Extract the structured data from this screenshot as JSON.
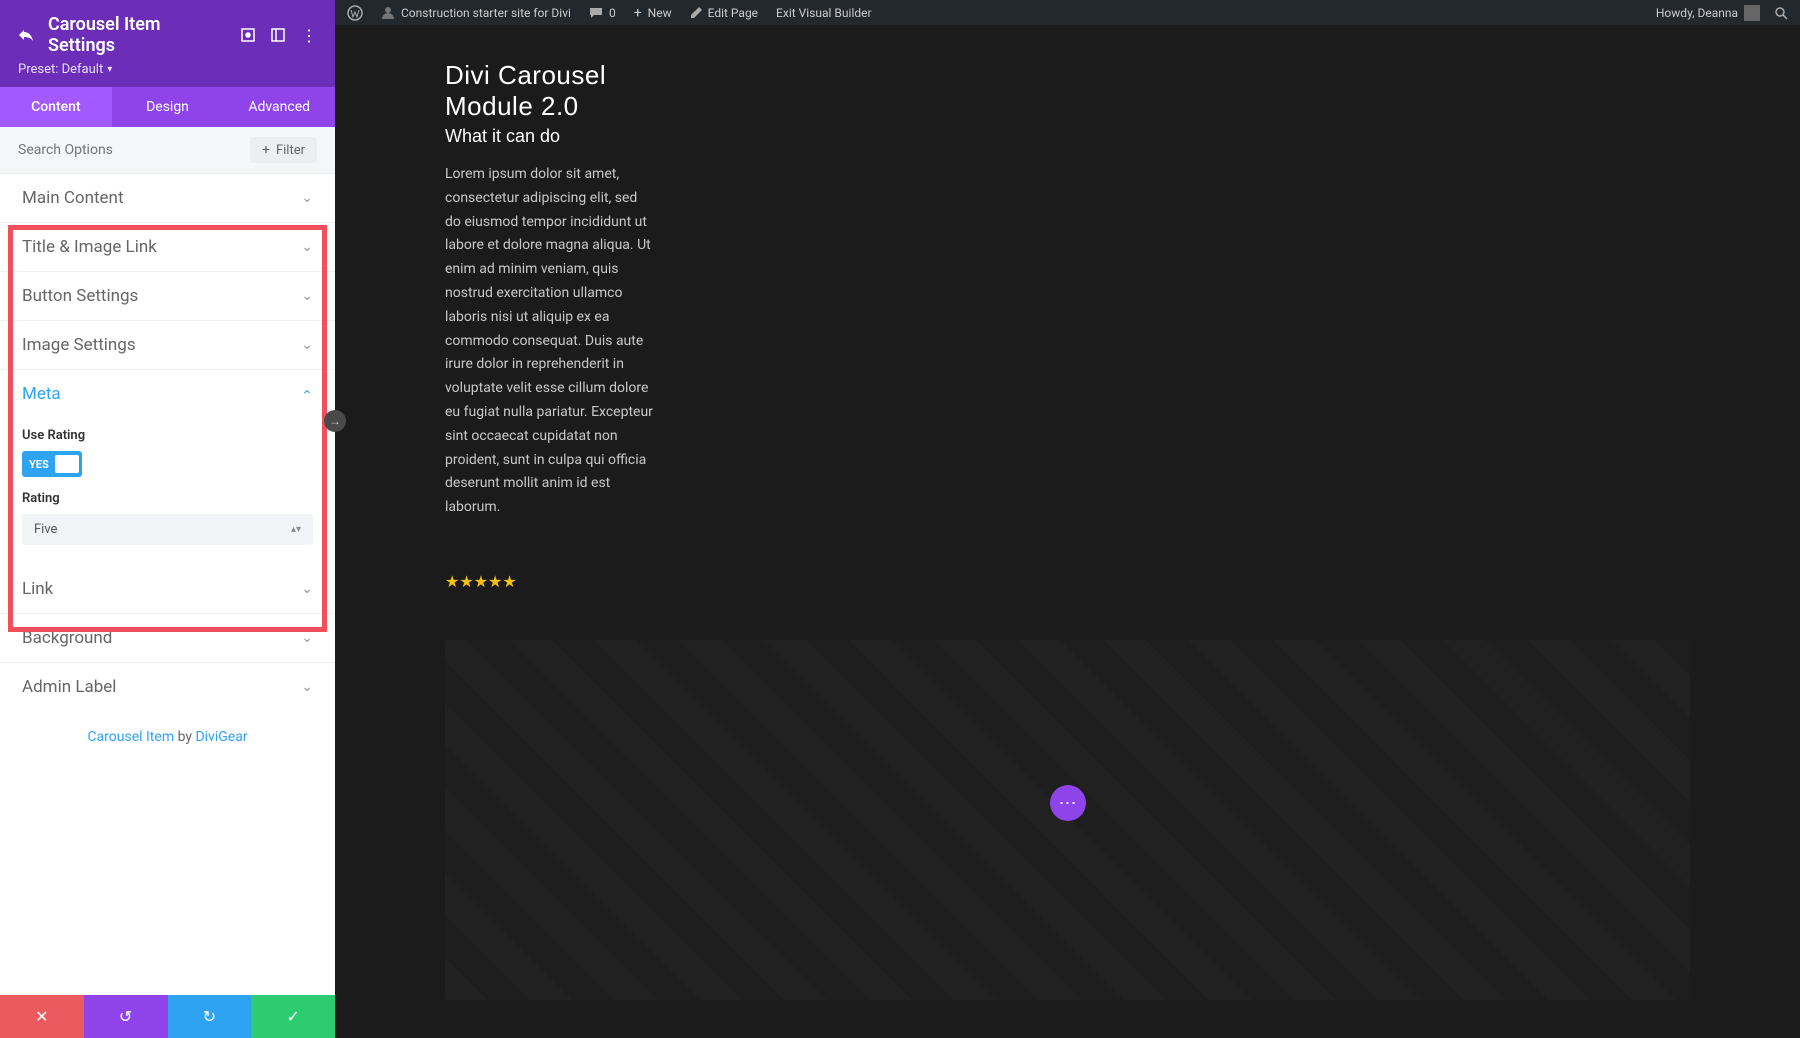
{
  "topbar": {
    "site": "Construction starter site for Divi",
    "comments": "0",
    "new": "New",
    "edit_page": "Edit Page",
    "exit_vb": "Exit Visual Builder",
    "howdy": "Howdy, Deanna"
  },
  "sidebar": {
    "title": "Carousel Item Settings",
    "preset": "Preset: Default",
    "tabs": {
      "content": "Content",
      "design": "Design",
      "advanced": "Advanced"
    },
    "search_placeholder": "Search Options",
    "filter_label": "Filter",
    "sections": {
      "main_content": "Main Content",
      "title_image_link": "Title & Image Link",
      "button_settings": "Button Settings",
      "image_settings": "Image Settings",
      "meta": "Meta",
      "link": "Link",
      "background": "Background",
      "admin_label": "Admin Label"
    },
    "meta_fields": {
      "use_rating_label": "Use Rating",
      "toggle_value": "YES",
      "rating_label": "Rating",
      "rating_value": "Five"
    },
    "credit": {
      "prefix": "Carousel Item",
      "by": " by ",
      "author": "DiviGear"
    }
  },
  "preview": {
    "title_line1": "Divi Carousel",
    "title_line2": "Module 2.0",
    "subtitle": "What it can do",
    "body": "Lorem ipsum dolor sit amet, consectetur adipiscing elit, sed do eiusmod tempor incididunt ut labore et dolore magna aliqua. Ut enim ad minim veniam, quis nostrud exercitation ullamco laboris nisi ut aliquip ex ea commodo consequat. Duis aute irure dolor in reprehenderit in voluptate velit esse cillum dolore eu fugiat nulla pariatur. Excepteur sint occaecat cupidatat non proident, sunt in culpa qui officia deserunt mollit anim id est laborum.",
    "stars": "★★★★★"
  },
  "fab": "⋯"
}
